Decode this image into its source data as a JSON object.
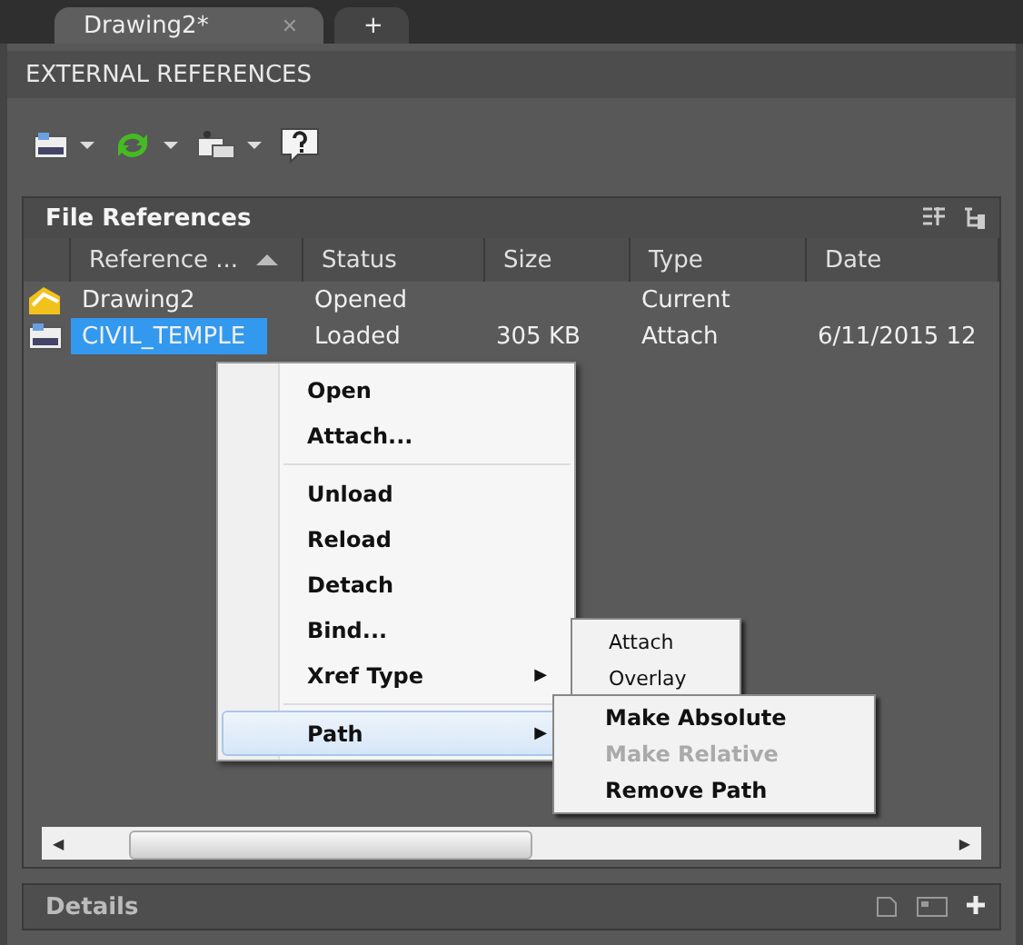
{
  "tabs": [
    {
      "label": "Drawing2*",
      "selected": true,
      "close": "✕"
    },
    {
      "label": "+",
      "selected": false
    }
  ],
  "palette_title": "EXTERNAL REFERENCES",
  "toolbar": [
    {
      "kind": "attach",
      "dropdown": true
    },
    {
      "kind": "refresh",
      "dropdown": true
    },
    {
      "kind": "change-path",
      "dropdown": true
    },
    {
      "kind": "help",
      "dropdown": false
    }
  ],
  "file_references": {
    "title": "File References",
    "columns": [
      {
        "label": "Reference ...",
        "sorted": true
      },
      {
        "label": "Status",
        "sorted": false
      },
      {
        "label": "Size",
        "sorted": false
      },
      {
        "label": "Type",
        "sorted": false
      },
      {
        "label": "Date",
        "sorted": false
      }
    ],
    "rows": [
      {
        "kind": "drawing",
        "selected": false,
        "cells": [
          "Drawing2",
          "Opened",
          "",
          "Current",
          ""
        ]
      },
      {
        "kind": "xref",
        "selected": true,
        "cells": [
          "CIVIL_TEMPLE",
          "Loaded",
          "305 KB",
          "Attach",
          "6/11/2015 12"
        ]
      }
    ]
  },
  "context_menu": {
    "groups": [
      [
        {
          "label": "Open",
          "submenu": false,
          "highlighted": false
        },
        {
          "label": "Attach...",
          "submenu": false,
          "highlighted": false
        }
      ],
      [
        {
          "label": "Unload",
          "submenu": false,
          "highlighted": false
        },
        {
          "label": "Reload",
          "submenu": false,
          "highlighted": false
        },
        {
          "label": "Detach",
          "submenu": false,
          "highlighted": false
        },
        {
          "label": "Bind...",
          "submenu": false,
          "highlighted": false
        },
        {
          "label": "Xref Type",
          "submenu": true,
          "highlighted": false
        }
      ],
      [
        {
          "label": "Path",
          "submenu": true,
          "highlighted": true
        }
      ]
    ],
    "arrow": "▶"
  },
  "xref_type_submenu": [
    {
      "label": "Attach",
      "disabled": false
    },
    {
      "label": "Overlay",
      "disabled": false
    }
  ],
  "path_submenu": [
    {
      "label": "Make Absolute",
      "disabled": false
    },
    {
      "label": "Make Relative",
      "disabled": true
    },
    {
      "label": "Remove Path",
      "disabled": false
    }
  ],
  "scrollbar": {
    "left": "◀",
    "right": "▶"
  },
  "details": {
    "title": "Details"
  }
}
